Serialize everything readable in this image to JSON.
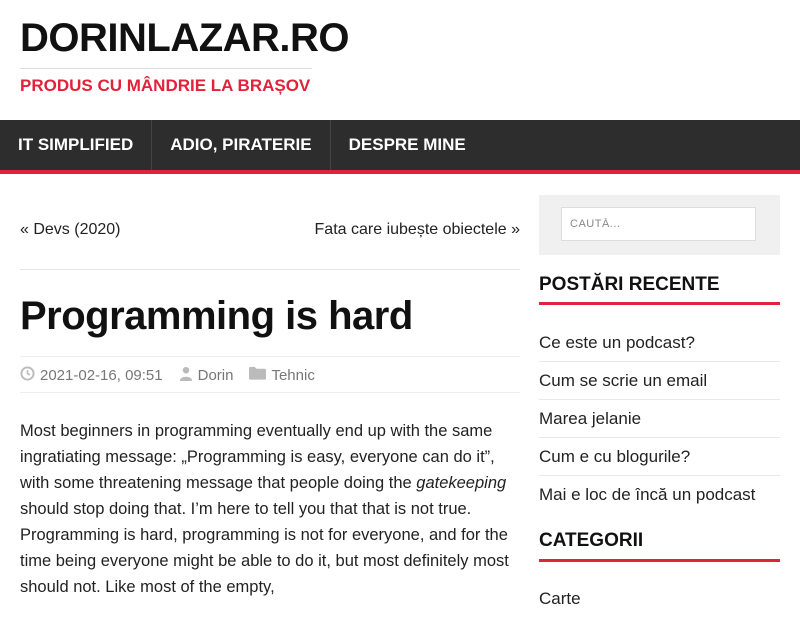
{
  "site": {
    "title": "DORINLAZAR.RO",
    "tagline": "PRODUS CU MÂNDRIE LA BRAȘOV"
  },
  "nav": {
    "items": [
      "IT SIMPLIFIED",
      "ADIO, PIRATERIE",
      "DESPRE MINE"
    ]
  },
  "post_nav": {
    "prev": "« Devs (2020)",
    "next": "Fata care iubește obiectele »"
  },
  "post": {
    "title": "Programming is hard",
    "date": "2021-02-16, 09:51",
    "author": "Dorin",
    "category": "Tehnic",
    "body_part1": "Most beginners in programming eventually end up with the same ingratiating message: „Programming is easy, everyone can do it”, with some threatening message that people doing the ",
    "body_em": "gatekeeping",
    "body_part2": " should stop doing that. I’m here to tell you that that is not true. Programming is hard, programming is not for everyone, and for the time being everyone might be able to do it, but most definitely most should not. Like most of the empty,"
  },
  "sidebar": {
    "search_placeholder": "CAUTĂ...",
    "recent_title": "POSTĂRI RECENTE",
    "recent_posts": [
      "Ce este un podcast?",
      "Cum se scrie un email",
      "Marea jelanie",
      "Cum e cu blogurile?",
      "Mai e loc de încă un podcast"
    ],
    "categories_title": "CATEGORII",
    "categories": [
      "Carte"
    ]
  },
  "colors": {
    "accent": "#e0223a",
    "nav_bg": "#2d2d2d"
  }
}
